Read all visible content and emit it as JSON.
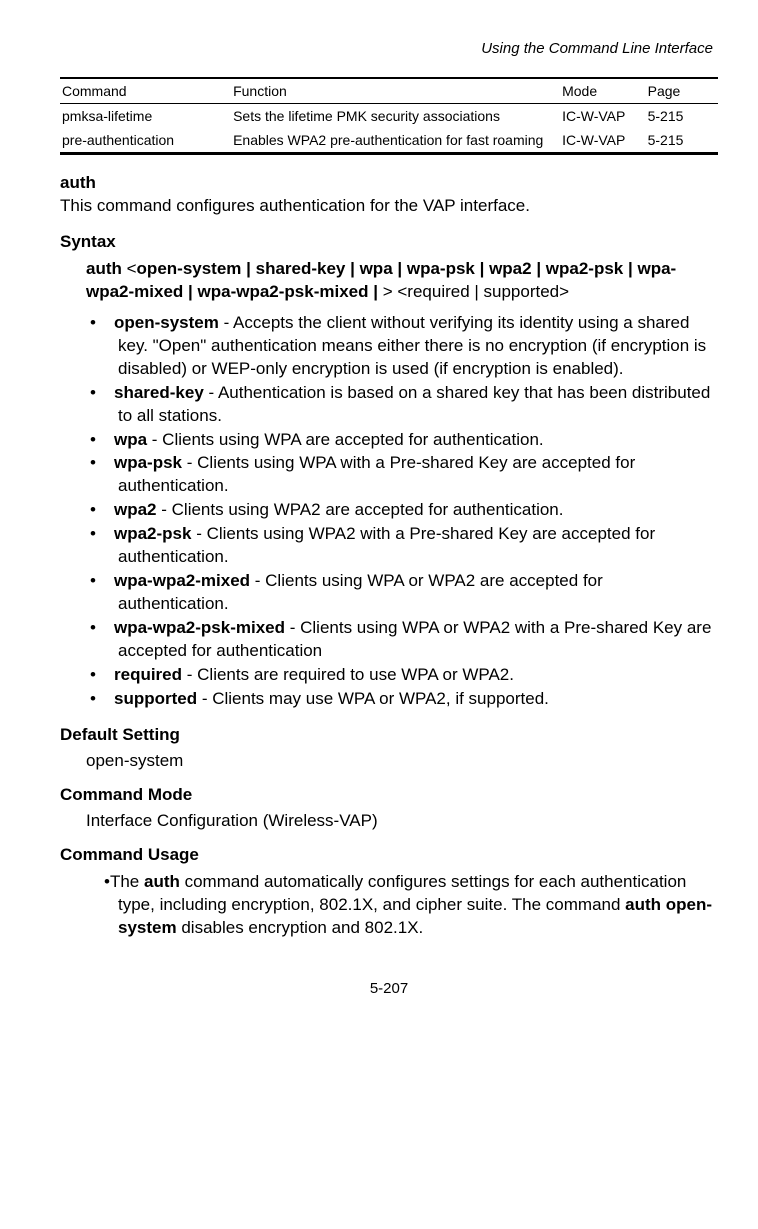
{
  "header": "Using the Command Line Interface",
  "table": {
    "headers": {
      "command": "Command",
      "function": "Function",
      "mode": "Mode",
      "page": "Page"
    },
    "rows": [
      {
        "command": "pmksa-lifetime",
        "function": "Sets the lifetime PMK security associations",
        "mode": "IC-W-VAP",
        "page": "5-215"
      },
      {
        "command": "pre-authentication",
        "function": "Enables WPA2 pre-authentication for fast roaming",
        "mode": "IC-W-VAP",
        "page": "5-215"
      }
    ]
  },
  "command_name": "auth",
  "command_description": "This command configures authentication for the VAP interface.",
  "syntax_heading": "Syntax",
  "syntax": {
    "prefix": "auth",
    "lt1": "<",
    "options_bold": "open-system | shared-key | wpa | wpa-psk | wpa2 | wpa2-psk | wpa-wpa2-mixed | wpa-wpa2-psk-mixed | ",
    "gt1": ">",
    "suffix_plain": " <required | supported>"
  },
  "definitions": [
    {
      "term": "open-system",
      "text": " - Accepts the client without verifying its identity using a shared key. \"Open\" authentication means either there is no encryption (if encryption is disabled) or WEP-only encryption is used (if encryption is enabled)."
    },
    {
      "term": "shared-key",
      "text": " - Authentication is based on a shared key that has been distributed to all stations."
    },
    {
      "term": "wpa",
      "text": " - Clients using WPA are accepted for authentication."
    },
    {
      "term": "wpa-psk",
      "text": " - Clients using WPA with a Pre-shared Key are accepted for authentication."
    },
    {
      "term": "wpa2",
      "text": " - Clients using WPA2 are accepted for authentication."
    },
    {
      "term": "wpa2-psk",
      "text": " - Clients using WPA2 with a Pre-shared Key are accepted for authentication."
    },
    {
      "term": "wpa-wpa2-mixed",
      "text": " - Clients using WPA or WPA2 are accepted for authentication."
    },
    {
      "term": "wpa-wpa2-psk-mixed",
      "text": " - Clients using WPA or WPA2 with a Pre-shared Key are accepted for authentication"
    },
    {
      "term": "required",
      "text": " - Clients are required to use WPA or WPA2."
    },
    {
      "term": "supported",
      "text": " - Clients may use WPA or WPA2, if supported."
    }
  ],
  "default_setting_heading": "Default Setting",
  "default_setting_value": "open-system",
  "command_mode_heading": "Command Mode",
  "command_mode_value": "Interface Configuration (Wireless-VAP)",
  "command_usage_heading": "Command Usage",
  "usage": {
    "prefix": "The ",
    "bold1": "auth",
    "mid": " command automatically configures settings for each authentication type, including encryption, 802.1X, and cipher suite. The command ",
    "bold2": "auth open-system",
    "suffix": " disables encryption and 802.1X."
  },
  "page_number": "5-207",
  "bullet": "•"
}
